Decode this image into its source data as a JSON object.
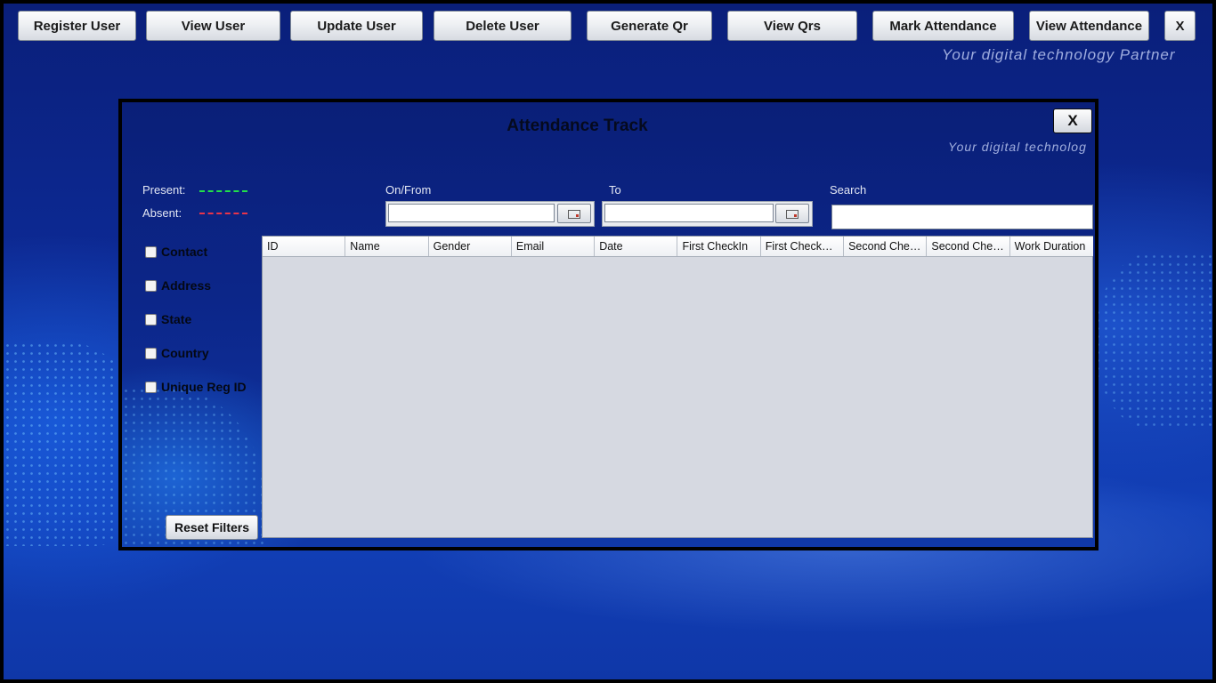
{
  "toolbar": {
    "buttons": [
      {
        "label": "Register User"
      },
      {
        "label": "View User"
      },
      {
        "label": "Update User"
      },
      {
        "label": "Delete User"
      },
      {
        "label": "Generate Qr"
      },
      {
        "label": "View Qrs"
      },
      {
        "label": "Mark Attendance"
      },
      {
        "label": "View Attendance"
      },
      {
        "label": "X"
      }
    ]
  },
  "tagline": "Your digital technology Partner",
  "dialog": {
    "title": "Attendance Track",
    "close_label": "X",
    "tagline": "Your digital technolog",
    "legend": {
      "present_label": "Present:",
      "present_color": "#22e04a",
      "absent_label": "Absent:",
      "absent_color": "#e8344a"
    },
    "from_label": "On/From",
    "from_value": "",
    "to_label": "To",
    "to_value": "",
    "search_label": "Search",
    "search_value": "",
    "filters": [
      {
        "label": "Contact",
        "checked": false
      },
      {
        "label": "Address",
        "checked": false
      },
      {
        "label": "State",
        "checked": false
      },
      {
        "label": "Country",
        "checked": false
      },
      {
        "label": "Unique Reg ID",
        "checked": false
      }
    ],
    "reset_label": "Reset Filters",
    "table": {
      "columns": [
        "ID",
        "Name",
        "Gender",
        "Email",
        "Date",
        "First CheckIn",
        "First CheckOut",
        "Second Chec...",
        "Second Chec...",
        "Work Duration"
      ],
      "rows": []
    }
  },
  "icons": {
    "calendar": "calendar-icon"
  }
}
